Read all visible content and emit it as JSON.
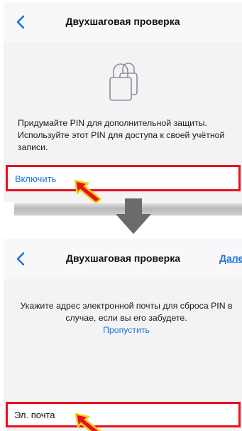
{
  "top_screen": {
    "nav": {
      "title": "Двухшаговая проверка",
      "back_icon": "chevron-left-icon"
    },
    "illustration_icon": "lock-icon",
    "description": "Придумайте PIN для дополнительной защиты. Используйте этот PIN для доступа к своей учётной записи.",
    "enable_label": "Включить"
  },
  "bottom_screen": {
    "nav": {
      "title": "Двухшаговая проверка",
      "next_label": "Далее",
      "back_icon": "chevron-left-icon"
    },
    "description": "Укажите адрес электронной почты для сброса PIN в случае, если вы его забудете.",
    "skip_label": "Пропустить",
    "email_placeholder": "Эл. почта"
  },
  "annotations": {
    "highlight_color": "#e8101c",
    "pointer_fill": "#e8101c",
    "pointer_outline": "#f7d21a",
    "transition_arrow_color": "#6b6b6b",
    "pointer_icon": "red-arrow-icon",
    "transition_icon": "down-arrow-icon"
  },
  "colors": {
    "link": "#1a73d6",
    "background": "#f3f3f6"
  }
}
